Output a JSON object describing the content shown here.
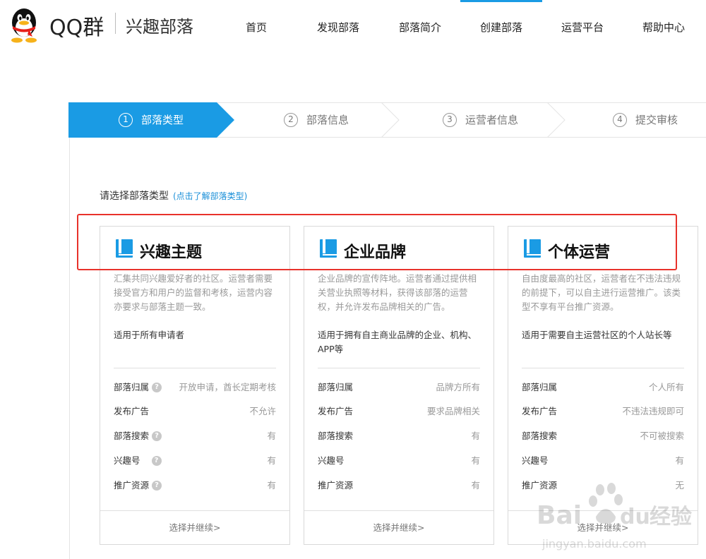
{
  "header": {
    "brand": "QQ群",
    "subtitle": "兴趣部落",
    "nav": [
      "首页",
      "发现部落",
      "部落简介",
      "创建部落",
      "运营平台",
      "帮助中心"
    ],
    "active_nav_index": 3
  },
  "steps": [
    {
      "num": "1",
      "label": "部落类型"
    },
    {
      "num": "2",
      "label": "部落信息"
    },
    {
      "num": "3",
      "label": "运营者信息"
    },
    {
      "num": "4",
      "label": "提交审核"
    }
  ],
  "active_step_index": 0,
  "prompt": {
    "text": "请选择部落类型",
    "link": "(点击了解部落类型)"
  },
  "cards": [
    {
      "title": "兴趣主题",
      "desc": "汇集共同兴趣爱好者的社区。运营者需要接受官方和用户的监督和考核，运营内容亦要求与部落主题一致。",
      "target": "适用于所有申请者",
      "attrs": [
        {
          "label": "部落归属",
          "value": "开放申请，酋长定期考核",
          "help": true
        },
        {
          "label": "发布广告",
          "value": "不允许",
          "help": false
        },
        {
          "label": "部落搜索",
          "value": "有",
          "help": true
        },
        {
          "label": "兴趣号",
          "value": "有",
          "help": true
        },
        {
          "label": "推广资源",
          "value": "有",
          "help": true
        }
      ],
      "footer": "选择并继续>"
    },
    {
      "title": "企业品牌",
      "desc": "企业品牌的宣传阵地。运营者通过提供相关营业执照等材料，获得该部落的运营权，并允许发布品牌相关的广告。",
      "target": "适用于拥有自主商业品牌的企业、机构、APP等",
      "attrs": [
        {
          "label": "部落归属",
          "value": "品牌方所有",
          "help": false
        },
        {
          "label": "发布广告",
          "value": "要求品牌相关",
          "help": false
        },
        {
          "label": "部落搜索",
          "value": "有",
          "help": false
        },
        {
          "label": "兴趣号",
          "value": "有",
          "help": false
        },
        {
          "label": "推广资源",
          "value": "有",
          "help": false
        }
      ],
      "footer": "选择并继续>"
    },
    {
      "title": "个体运营",
      "desc": "自由度最高的社区，运营者在不违法违规的前提下，可以自主进行运营推广。该类型不享有平台推广资源。",
      "target": "适用于需要自主运营社区的个人站长等",
      "attrs": [
        {
          "label": "部落归属",
          "value": "个人所有",
          "help": false
        },
        {
          "label": "发布广告",
          "value": "不违法违规即可",
          "help": false
        },
        {
          "label": "部落搜索",
          "value": "不可被搜索",
          "help": false
        },
        {
          "label": "兴趣号",
          "value": "有",
          "help": false
        },
        {
          "label": "推广资源",
          "value": "无",
          "help": false
        }
      ],
      "footer": "选择并继续>"
    }
  ],
  "watermark": {
    "brand": "Bai",
    "brand2": "du",
    "cn": "经验",
    "url": "jingyan.baidu.com"
  },
  "colors": {
    "accent": "#1a9be4",
    "highlight_box": "#e8322b"
  }
}
